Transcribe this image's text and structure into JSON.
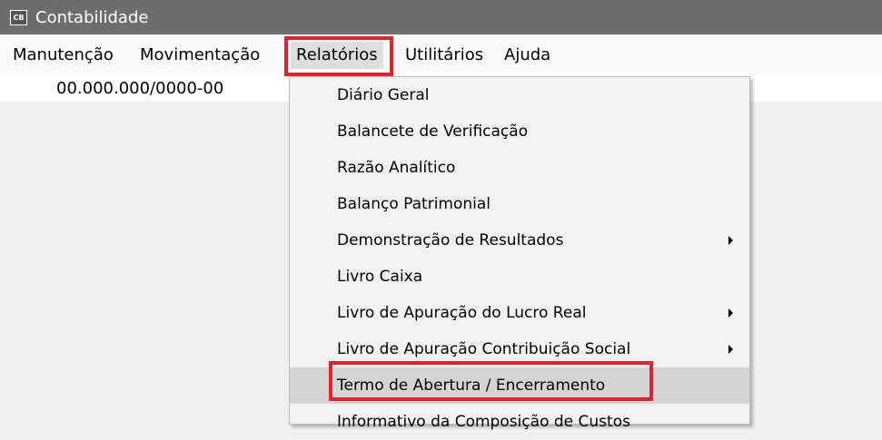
{
  "window": {
    "title": "Contabilidade",
    "icon_text": "CB"
  },
  "menubar": {
    "items": [
      {
        "label": "Manutenção"
      },
      {
        "label": "Movimentação"
      },
      {
        "label": "Relatórios",
        "open": true
      },
      {
        "label": "Utilitários"
      },
      {
        "label": "Ajuda"
      }
    ]
  },
  "company": {
    "cnpj": "00.000.000/0000-00"
  },
  "relatorios_menu": {
    "items": [
      {
        "label": "Diário Geral"
      },
      {
        "label": "Balancete de Verificação"
      },
      {
        "label": "Razão Analítico"
      },
      {
        "label": "Balanço Patrimonial"
      },
      {
        "label": "Demonstração de Resultados",
        "submenu": true
      },
      {
        "label": "Livro Caixa"
      },
      {
        "label": "Livro de Apuração do Lucro Real",
        "submenu": true
      },
      {
        "label": "Livro de Apuração Contribuição Social",
        "submenu": true
      },
      {
        "label": "Termo de Abertura / Encerramento",
        "highlighted": true
      },
      {
        "label": "Informativo da Composição de Custos"
      }
    ]
  },
  "colors": {
    "titlebar": "#6d6d6d",
    "highlight": "#e2222d",
    "hover": "#d4d4d4"
  }
}
